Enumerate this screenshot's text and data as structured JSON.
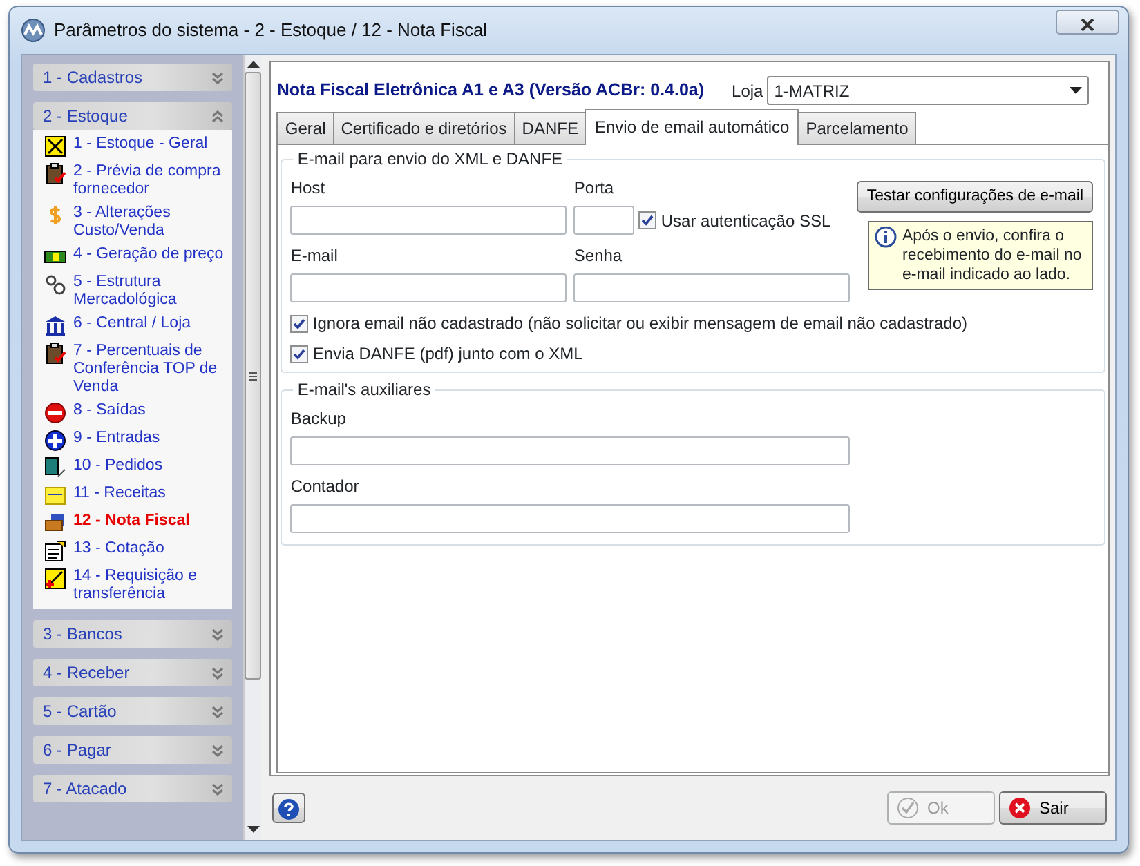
{
  "window": {
    "title": "Parâmetros do sistema - 2 - Estoque / 12 - Nota Fiscal"
  },
  "sidebar": {
    "groups": [
      {
        "title": "1 - Cadastros",
        "expanded": false
      },
      {
        "title": "2 - Estoque",
        "expanded": true,
        "items": [
          {
            "label": "1 - Estoque - Geral",
            "selected": false
          },
          {
            "label": "2 - Prévia de compra fornecedor",
            "selected": false
          },
          {
            "label": "3 - Alterações Custo/Venda",
            "selected": false
          },
          {
            "label": "4 - Geração de preço",
            "selected": false
          },
          {
            "label": "5 - Estrutura Mercadológica",
            "selected": false
          },
          {
            "label": "6 - Central / Loja",
            "selected": false
          },
          {
            "label": "7 - Percentuais de Conferência TOP de Venda",
            "selected": false
          },
          {
            "label": "8 - Saídas",
            "selected": false
          },
          {
            "label": "9 - Entradas",
            "selected": false
          },
          {
            "label": "10 - Pedidos",
            "selected": false
          },
          {
            "label": "11 - Receitas",
            "selected": false
          },
          {
            "label": "12 - Nota Fiscal",
            "selected": true
          },
          {
            "label": "13 - Cotação",
            "selected": false
          },
          {
            "label": "14 - Requisição e transferência",
            "selected": false
          }
        ]
      },
      {
        "title": "3 - Bancos",
        "expanded": false
      },
      {
        "title": "4 - Receber",
        "expanded": false
      },
      {
        "title": "5 - Cartão",
        "expanded": false
      },
      {
        "title": "6 - Pagar",
        "expanded": false
      },
      {
        "title": "7 - Atacado",
        "expanded": false
      }
    ]
  },
  "panel": {
    "heading": "Nota Fiscal Eletrônica A1 e A3 (Versão ACBr: 0.4.0a)",
    "store_label": "Loja",
    "store_value": "1-MATRIZ",
    "tabs": [
      {
        "label": "Geral",
        "selected": false
      },
      {
        "label": "Certificado e diretórios",
        "selected": false
      },
      {
        "label": "DANFE",
        "selected": false
      },
      {
        "label": "Envio de email automático",
        "selected": true
      },
      {
        "label": "Parcelamento",
        "selected": false
      }
    ],
    "email_group": {
      "legend": "E-mail para envio do XML e DANFE",
      "host_label": "Host",
      "port_label": "Porta",
      "ssl": {
        "label": "Usar autenticação SSL",
        "checked": true
      },
      "email_label": "E-mail",
      "password_label": "Senha",
      "test_button": "Testar configurações de e-mail",
      "info": "Após o envio, confira o recebimento do e-mail no e-mail indicado ao lado.",
      "options": [
        {
          "label": "Ignora email não cadastrado (não solicitar ou exibir mensagem de email não cadastrado)",
          "checked": true
        },
        {
          "label": "Envia DANFE (pdf) junto com o XML",
          "checked": true
        }
      ]
    },
    "aux_group": {
      "legend": "E-mail's auxiliares",
      "fields": [
        {
          "label": "Backup"
        },
        {
          "label": "Contador"
        }
      ]
    }
  },
  "buttons": [
    {
      "label": "Ok",
      "disabled": true
    },
    {
      "label": "Sair",
      "disabled": false
    }
  ]
}
